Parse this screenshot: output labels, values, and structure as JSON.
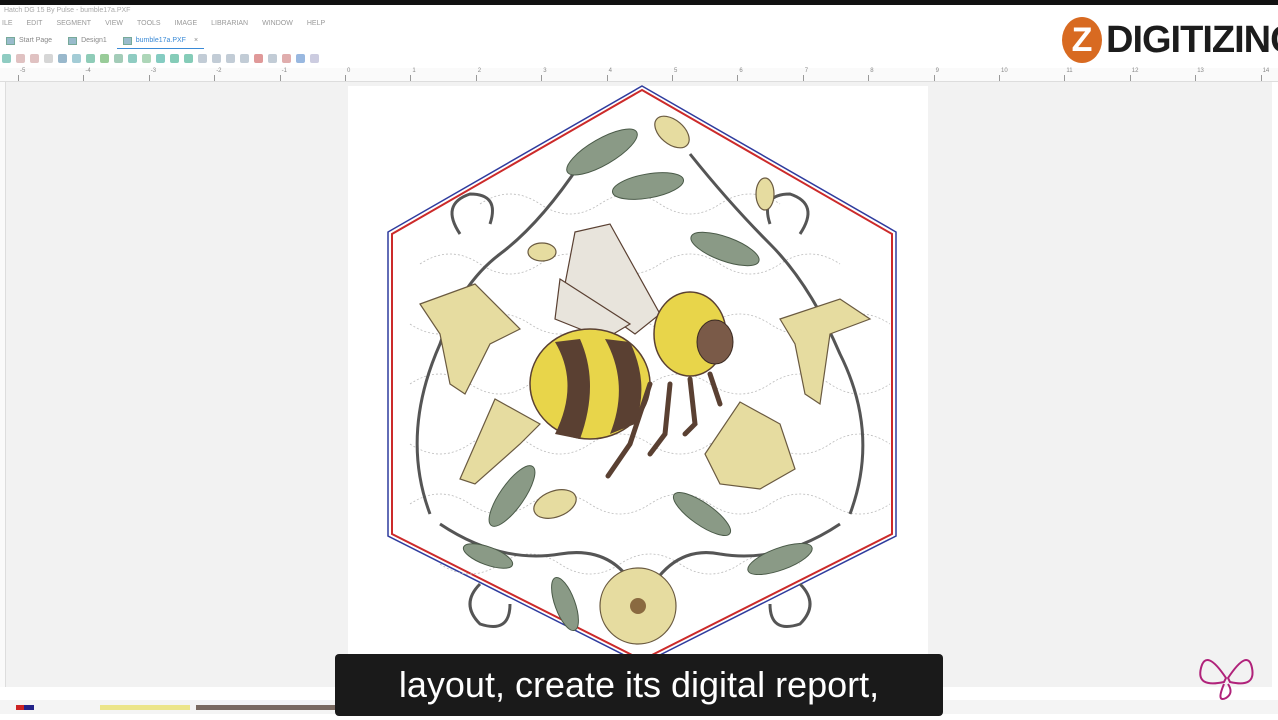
{
  "window": {
    "title": "Hatch DG 15 By Pulse - bumble17a.PXF"
  },
  "menu": [
    "ILE",
    "EDIT",
    "SEGMENT",
    "VIEW",
    "TOOLS",
    "IMAGE",
    "LIBRARIAN",
    "WINDOW",
    "HELP"
  ],
  "tabs": [
    {
      "label": "Start Page",
      "active": false
    },
    {
      "label": "Design1",
      "active": false
    },
    {
      "label": "bumble17a.PXF",
      "active": true
    }
  ],
  "tab_close": "×",
  "ruler": {
    "labels": [
      "-5",
      "-4",
      "-3",
      "-2",
      "-1",
      "0",
      "1",
      "2",
      "3",
      "4",
      "5",
      "6",
      "7",
      "8",
      "9",
      "10",
      "11",
      "12",
      "13",
      "14"
    ]
  },
  "logo": {
    "badge": "Z",
    "text": "DIGITIZING",
    "badge_color": "#d86a21"
  },
  "caption": {
    "text": "layout, create its digital report,"
  },
  "colors": {
    "hex_outline_red": "#cc2a2a",
    "hex_outline_blue": "#2f3c9e",
    "bee_yellow": "#e8d54a",
    "bee_brown": "#5a4032",
    "leaf_green": "#8a9a86",
    "flower_cream": "#e6dca0"
  },
  "icons": {
    "butterfly": "butterfly-icon",
    "tab_doc": "document-icon"
  }
}
